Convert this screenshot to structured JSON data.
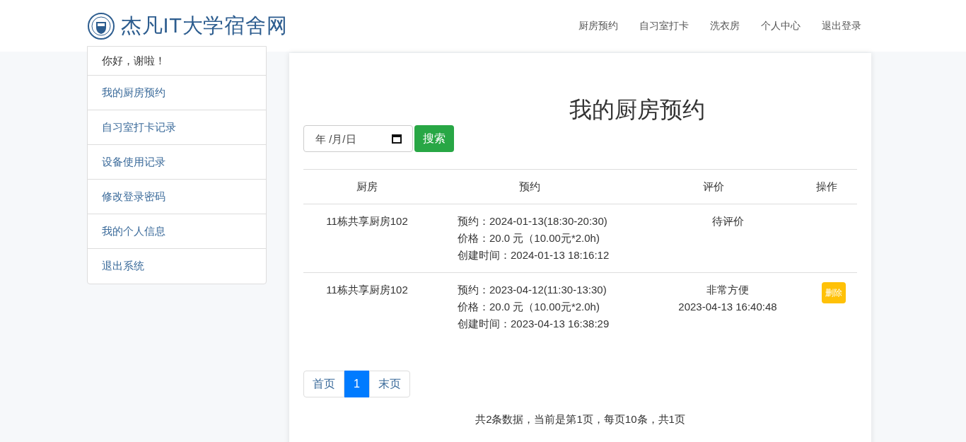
{
  "header": {
    "site_title": "杰凡IT大学宿舍网",
    "nav": [
      {
        "label": "厨房预约"
      },
      {
        "label": "自习室打卡"
      },
      {
        "label": "洗衣房"
      },
      {
        "label": "个人中心"
      },
      {
        "label": "退出登录"
      }
    ]
  },
  "sidebar": {
    "greeting": "你好，谢啦！",
    "items": [
      {
        "label": "我的厨房预约"
      },
      {
        "label": "自习室打卡记录"
      },
      {
        "label": "设备使用记录"
      },
      {
        "label": "修改登录密码"
      },
      {
        "label": "我的个人信息"
      },
      {
        "label": "退出系统"
      }
    ]
  },
  "main": {
    "title": "我的厨房预约",
    "date_filter": {
      "placeholder": "年 /月/日"
    },
    "search_button": "搜索",
    "table": {
      "columns": [
        "厨房",
        "预约",
        "评价",
        "操作"
      ],
      "rows": [
        {
          "kitchen": "11栋共享厨房102",
          "booking": [
            "预约：2024-01-13(18:30-20:30)",
            "价格：20.0 元（10.00元*2.0h)",
            "创建时间：2024-01-13 18:16:12"
          ],
          "review": [
            "待评价"
          ]
        },
        {
          "kitchen": "11栋共享厨房102",
          "booking": [
            "预约：2023-04-12(11:30-13:30)",
            "价格：20.0 元（10.00元*2.0h)",
            "创建时间：2023-04-13 16:38:29"
          ],
          "review": [
            "非常方便",
            "2023-04-13 16:40:48"
          ],
          "action": "删除"
        }
      ]
    },
    "pagination": [
      {
        "label": "首页",
        "selected": false
      },
      {
        "label": "1",
        "selected": true
      },
      {
        "label": "末页",
        "selected": false
      }
    ],
    "summary": "共2条数据，当前是第1页，每页10条，共1页"
  }
}
